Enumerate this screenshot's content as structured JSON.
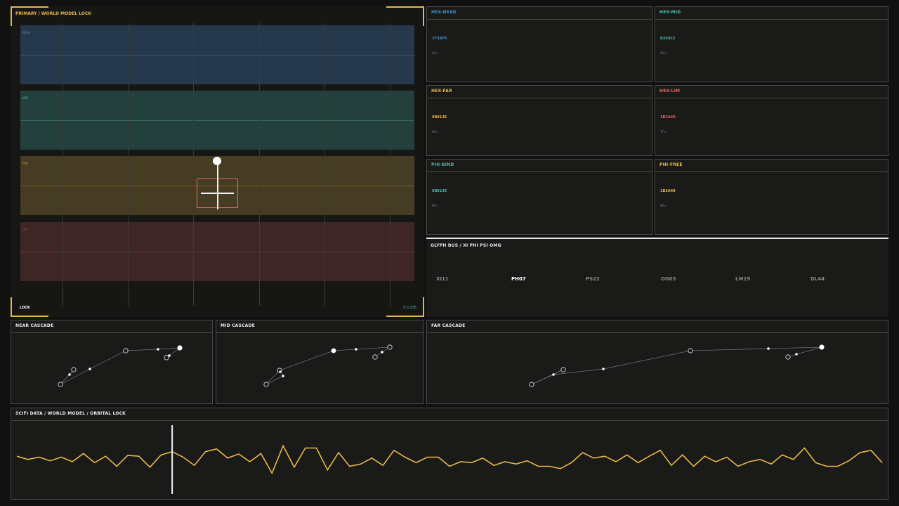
{
  "primary": {
    "title": "PRIMARY / WORLD MODEL LOCK",
    "lock_label": "LOCK",
    "coord_label": "X:0.238",
    "bands": [
      {
        "label": "NEAR",
        "bg": "#26384b",
        "line": "#5f8bb5",
        "text": "#5f8bb5"
      },
      {
        "label": "MID",
        "bg": "#24403c",
        "line": "#5ab0a0",
        "text": "#5ab0a0"
      },
      {
        "label": "FAR",
        "bg": "#463c23",
        "line": "#c9a24a",
        "text": "#c9a24a"
      },
      {
        "label": "LIM",
        "bg": "#3e2627",
        "line": "#b05656",
        "text": "#b05656"
      }
    ]
  },
  "cards": [
    {
      "title": "HEX-NEAR",
      "value": "1F3AF8",
      "sub": "40 s",
      "color": "#3f8fd6"
    },
    {
      "title": "HEX-MID",
      "value": "B264C2",
      "sub": "40 s",
      "color": "#4fb9a8"
    },
    {
      "title": "HEX-FAR",
      "value": "9B913E",
      "sub": "40 s",
      "color": "#e8b74a"
    },
    {
      "title": "HEX-LIM",
      "value": "1B2A40",
      "sub": "TT s",
      "color": "#e06a6a"
    },
    {
      "title": "PHI-BIND",
      "value": "9B913E",
      "sub": "80 s",
      "color": "#4fb9a8"
    },
    {
      "title": "PHI-FREE",
      "value": "1B2A40",
      "sub": "80 s",
      "color": "#e8b74a"
    }
  ],
  "glyph": {
    "title": "GLYPH BUS / XI PHI PSI OMG",
    "items": [
      "XI11",
      "PH07",
      "PS22",
      "OG03",
      "LM19",
      "DL44"
    ],
    "active_index": 1
  },
  "cascades": [
    {
      "title": "NEAR CASCADE"
    },
    {
      "title": "MID CASCADE"
    },
    {
      "title": "FAR CASCADE"
    }
  ],
  "timeline": {
    "title": "SCIFI DATA / WORLD MODEL / ORBITAL LOCK",
    "line_color": "#e8b74a",
    "cursor_index": 14,
    "values": [
      0.52,
      0.45,
      0.5,
      0.42,
      0.5,
      0.4,
      0.58,
      0.38,
      0.52,
      0.3,
      0.54,
      0.52,
      0.28,
      0.55,
      0.62,
      0.5,
      0.32,
      0.62,
      0.68,
      0.48,
      0.57,
      0.4,
      0.58,
      0.15,
      0.75,
      0.28,
      0.7,
      0.7,
      0.22,
      0.6,
      0.3,
      0.35,
      0.48,
      0.32,
      0.65,
      0.5,
      0.38,
      0.5,
      0.5,
      0.3,
      0.4,
      0.38,
      0.48,
      0.32,
      0.4,
      0.35,
      0.42,
      0.3,
      0.3,
      0.25,
      0.38,
      0.6,
      0.48,
      0.52,
      0.4,
      0.55,
      0.38,
      0.52,
      0.65,
      0.32,
      0.55,
      0.3,
      0.52,
      0.4,
      0.5,
      0.3,
      0.4,
      0.45,
      0.35,
      0.55,
      0.45,
      0.7,
      0.38,
      0.3,
      0.3,
      0.42,
      0.6,
      0.65,
      0.38
    ]
  }
}
